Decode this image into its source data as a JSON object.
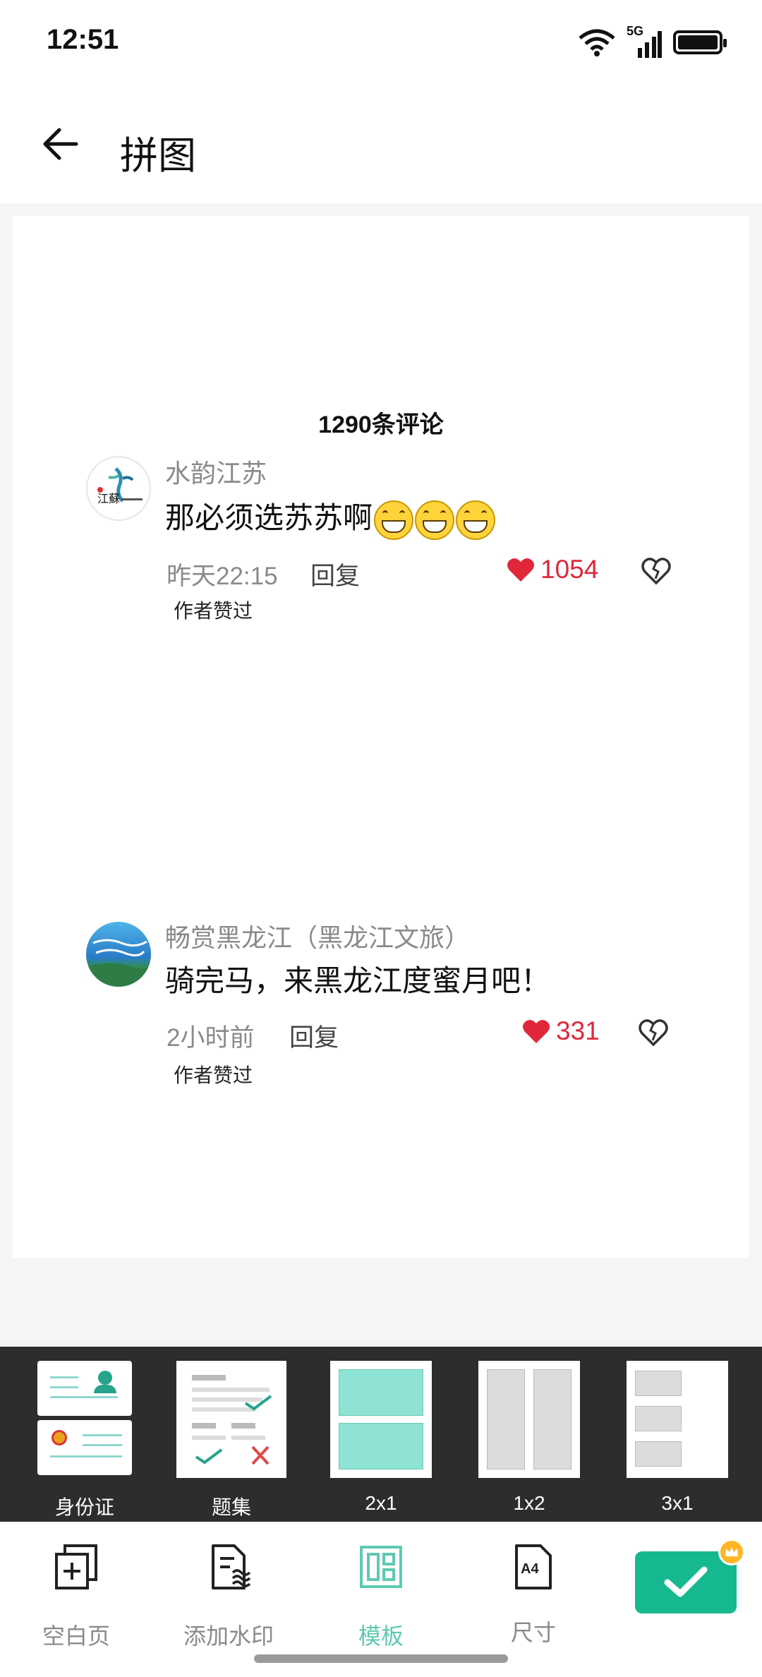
{
  "status_bar": {
    "time": "12:51",
    "network": "5G",
    "icons": [
      "wifi-icon",
      "signal-icon",
      "battery-icon"
    ]
  },
  "header": {
    "title": "拼图",
    "back_icon": "arrow-left-icon"
  },
  "page": {
    "comments_title": "1290条评论",
    "comments": [
      {
        "user": "水韵江苏",
        "text": "那必须选苏苏啊",
        "emoji_count": 3,
        "time": "昨天22:15",
        "reply": "回复",
        "likes": "1054",
        "author_liked": "作者赞过"
      },
      {
        "user": "畅赏黑龙江（黑龙江文旅）",
        "text": "骑完马，来黑龙江度蜜月吧！",
        "time": "2小时前",
        "reply": "回复",
        "likes": "331",
        "author_liked": "作者赞过"
      }
    ]
  },
  "templates": [
    {
      "label": "身份证",
      "icon": "id-card-template-icon"
    },
    {
      "label": "题集",
      "icon": "question-set-template-icon"
    },
    {
      "label": "2x1",
      "icon": "two-rows-template-icon"
    },
    {
      "label": "1x2",
      "icon": "two-columns-template-icon"
    },
    {
      "label": "3x1",
      "icon": "three-rows-template-icon"
    }
  ],
  "bottom_nav": {
    "items": [
      {
        "label": "空白页",
        "icon": "add-page-icon"
      },
      {
        "label": "添加水印",
        "icon": "watermark-icon"
      },
      {
        "label": "模板",
        "icon": "template-icon",
        "active": true
      },
      {
        "label": "尺寸",
        "icon": "a4-size-icon",
        "badge": "A4"
      }
    ],
    "confirm_icon": "checkmark-icon"
  },
  "colors": {
    "accent": "#16b98f",
    "active_tab": "#5fc9b2",
    "like_red": "#e0273a",
    "template_fill": "#8ee3d4",
    "dark_bar": "#2d2d2d"
  }
}
